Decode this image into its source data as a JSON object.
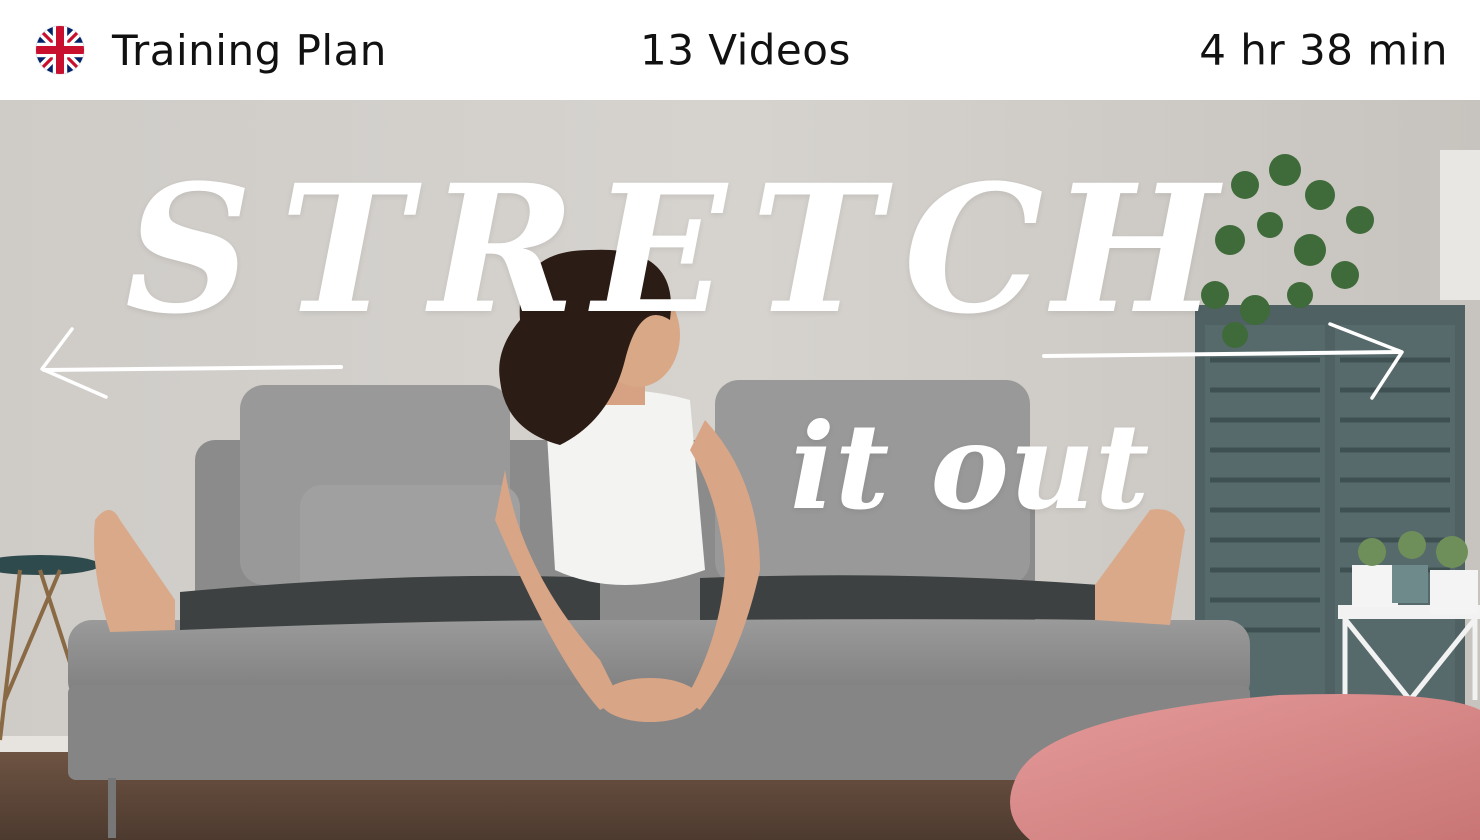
{
  "header": {
    "flag_icon": "uk-flag-icon",
    "plan_label": "Training Plan",
    "videos_label": "13 Videos",
    "duration_label": "4 hr 38 min"
  },
  "hero": {
    "title_letters": [
      "S",
      "T",
      "R",
      "E",
      "T",
      "C",
      "H"
    ],
    "subtitle": "it out",
    "left_arrow_icon": "arrow-left-icon",
    "right_arrow_icon": "arrow-right-icon"
  },
  "colors": {
    "header_bg": "#ffffff",
    "header_text": "#111111",
    "title_text": "#ffffff",
    "wall": "#cdc9c5",
    "sofa": "#8f8f8f",
    "cabinet": "#4f6163",
    "pillow": "#d98a8a"
  }
}
